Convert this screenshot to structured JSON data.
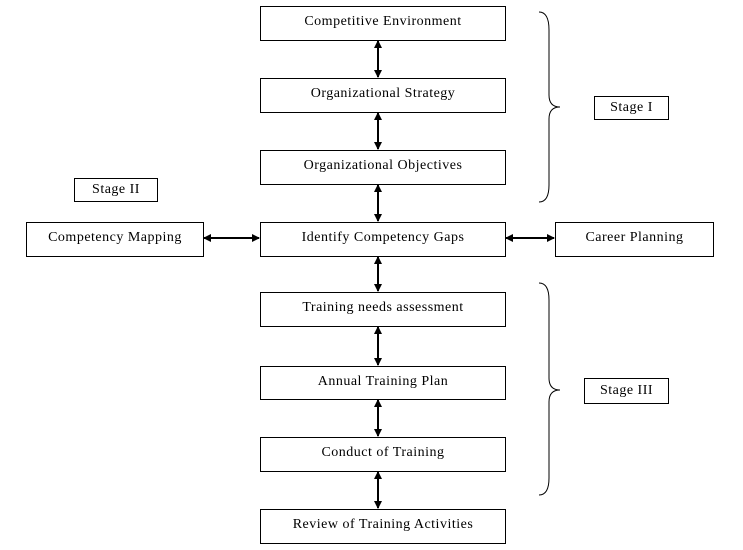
{
  "flow": [
    "Competitive Environment",
    "Organizational Strategy",
    "Organizational Objectives",
    "Identify Competency Gaps",
    "Training needs assessment",
    "Annual Training Plan",
    "Conduct of Training",
    "Review of Training Activities"
  ],
  "left_node": "Competency Mapping",
  "right_node": "Career Planning",
  "stages": {
    "stage1": "Stage I",
    "stage2": "Stage II",
    "stage3": "Stage III"
  }
}
